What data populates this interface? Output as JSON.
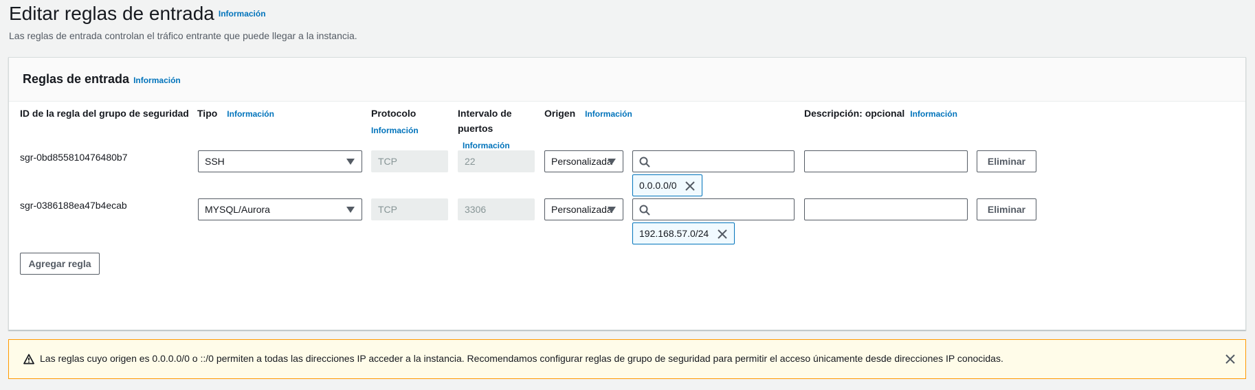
{
  "header": {
    "title": "Editar reglas de entrada",
    "info": "Información",
    "description": "Las reglas de entrada controlan el tráfico entrante que puede llegar a la instancia."
  },
  "panel": {
    "title": "Reglas de entrada",
    "info": "Información",
    "columns": {
      "rule_id": "ID de la regla del grupo de seguridad",
      "type": "Tipo",
      "type_info": "Información",
      "protocol": "Protocolo",
      "protocol_info": "Información",
      "port_range_line1": "Intervalo de",
      "port_range_line2": "puertos",
      "port_range_info": "Información",
      "source": "Origen",
      "source_info": "Información",
      "description": "Descripción: opcional",
      "description_info": "Información"
    },
    "rules": [
      {
        "id": "sgr-0bd855810476480b7",
        "type": "SSH",
        "protocol": "TCP",
        "port": "22",
        "source_mode": "Personalizada",
        "source_search": "",
        "source_token": "0.0.0.0/0",
        "description": "",
        "delete_label": "Eliminar"
      },
      {
        "id": "sgr-0386188ea47b4ecab",
        "type": "MYSQL/Aurora",
        "protocol": "TCP",
        "port": "3306",
        "source_mode": "Personalizada",
        "source_search": "",
        "source_token": "192.168.57.0/24",
        "description": "",
        "delete_label": "Eliminar"
      }
    ],
    "add_rule_label": "Agregar regla"
  },
  "warning": {
    "text": "Las reglas cuyo origen es 0.0.0.0/0 o ::/0 permiten a todas las direcciones IP acceder a la instancia. Recomendamos configurar reglas de grupo de seguridad para permitir el acceso únicamente desde direcciones IP conocidas.",
    "icon": "warning-icon",
    "close_icon": "close-icon"
  },
  "colors": {
    "link": "#0073bb",
    "warning_border": "#ff9900",
    "warning_bg": "#fffce9",
    "token_border": "#0073bb",
    "token_bg": "#f1faff"
  }
}
